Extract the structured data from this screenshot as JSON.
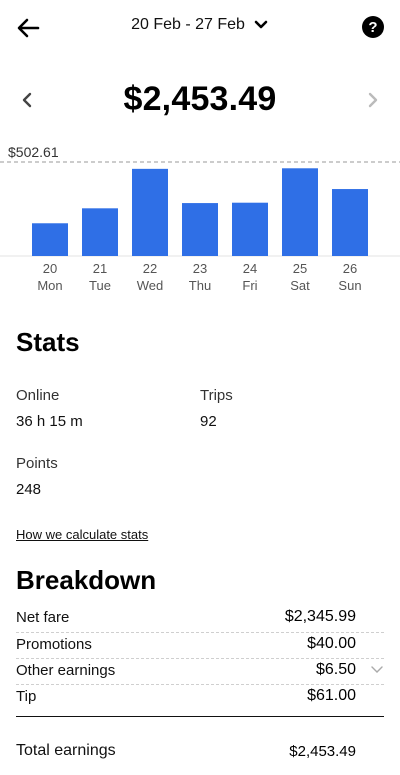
{
  "header": {
    "date_range": "20 Feb - 27 Feb"
  },
  "summary": {
    "total": "$2,453.49"
  },
  "chart_data": {
    "type": "bar",
    "categories": [
      "20",
      "21",
      "22",
      "23",
      "24",
      "25",
      "26"
    ],
    "day_names": [
      "Mon",
      "Tue",
      "Wed",
      "Thu",
      "Fri",
      "Sat",
      "Sun"
    ],
    "values": [
      175,
      255,
      466,
      283,
      285,
      469,
      358
    ],
    "max_label": "$502.61",
    "ylim": [
      0,
      502.61
    ],
    "bar_color": "#2f6fe6"
  },
  "stats": {
    "title": "Stats",
    "online_label": "Online",
    "online_value": "36 h 15 m",
    "trips_label": "Trips",
    "trips_value": "92",
    "points_label": "Points",
    "points_value": "248",
    "how_link": "How we calculate stats"
  },
  "breakdown": {
    "title": "Breakdown",
    "rows": [
      {
        "label": "Net fare",
        "value": "$2,345.99"
      },
      {
        "label": "Promotions",
        "value": "$40.00"
      },
      {
        "label": "Other earnings",
        "value": "$6.50"
      },
      {
        "label": "Tip",
        "value": "$61.00"
      }
    ],
    "total_label": "Total earnings",
    "total_value": "$2,453.49"
  }
}
